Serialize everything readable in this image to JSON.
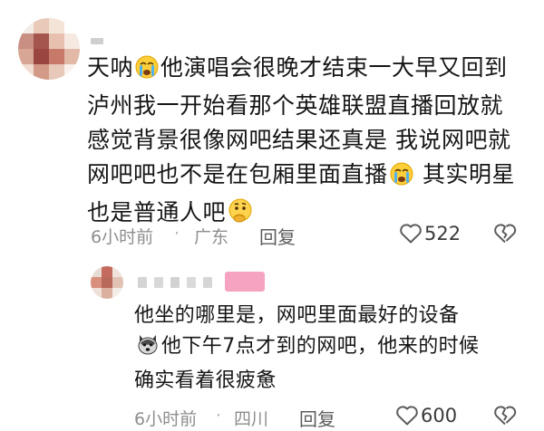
{
  "comment": {
    "author_avatar": "mosaic-avatar",
    "lines": [
      {
        "before": "天呐",
        "emoji": "crying-face",
        "after": "他演唱会很晚才结束一大早又回到"
      },
      {
        "text": "泸州我一开始看那个英雄联盟直播回放就"
      },
      {
        "text": "感觉背景很像网吧结果还真是 我说网吧就"
      },
      {
        "before": "网吧吧也不是在包厢里面直播",
        "emoji": "crying-face",
        "after": " 其实明星"
      },
      {
        "before": "也是普通人吧",
        "emoji": "thinking-face",
        "after": ""
      }
    ],
    "time": "6小时前",
    "separator": "·",
    "location": "广东",
    "reply_label": "回复",
    "like_count": "522"
  },
  "reply": {
    "author_avatar": "mosaic-avatar",
    "lines": [
      {
        "text": "他坐的哪里是，网吧里面最好的设备"
      },
      {
        "before": "",
        "emoji": "dog-face",
        "after": "他下午7点才到的网吧，他来的时候"
      },
      {
        "text": "确实看着很疲惫"
      }
    ],
    "time": "6小时前",
    "separator": "·",
    "location": "四川",
    "reply_label": "回复",
    "like_count": "600"
  },
  "colors": {
    "text": "#161616",
    "meta": "#8e8e8e",
    "tag_pink": "#f5a3c0"
  }
}
